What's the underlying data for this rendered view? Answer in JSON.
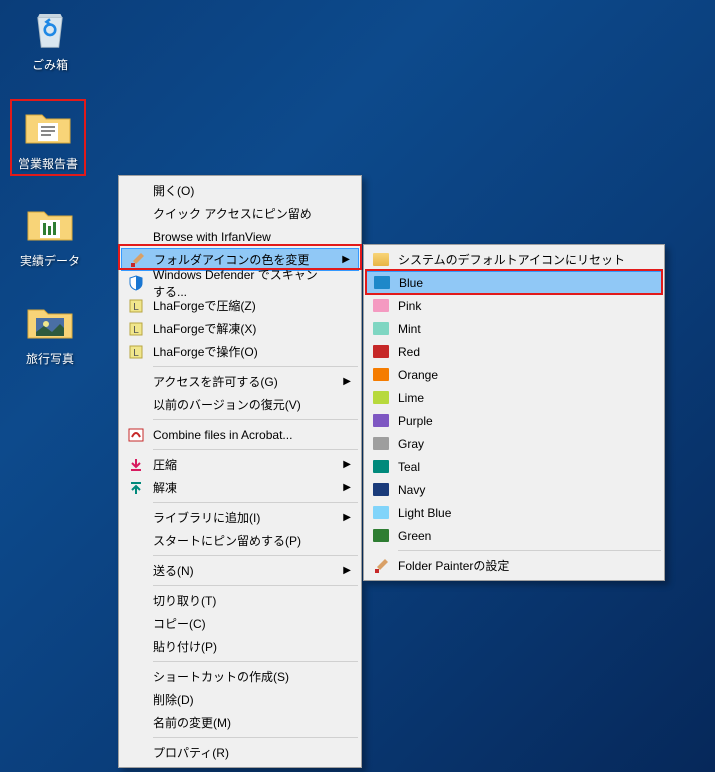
{
  "desktop": {
    "icons": [
      {
        "label": "ごみ箱"
      },
      {
        "label": "営業報告書"
      },
      {
        "label": "実績データ"
      },
      {
        "label": "旅行写真"
      }
    ]
  },
  "menu1": {
    "items": [
      {
        "label": "開く(O)"
      },
      {
        "label": "クイック アクセスにピン留め"
      },
      {
        "label": "Browse with IrfanView"
      },
      {
        "label": "フォルダアイコンの色を変更",
        "arrow": true,
        "hovered": true,
        "icon": "brush"
      },
      {
        "label": "Windows Defender でスキャンする...",
        "icon": "defender"
      },
      {
        "label": "LhaForgeで圧縮(Z)",
        "icon": "lha-z"
      },
      {
        "label": "LhaForgeで解凍(X)",
        "icon": "lha-x"
      },
      {
        "label": "LhaForgeで操作(O)",
        "icon": "lha-o"
      },
      {
        "sep": true
      },
      {
        "label": "アクセスを許可する(G)",
        "arrow": true
      },
      {
        "label": "以前のバージョンの復元(V)"
      },
      {
        "sep": true
      },
      {
        "label": "Combine files in Acrobat...",
        "icon": "acrobat"
      },
      {
        "sep": true
      },
      {
        "label": "圧縮",
        "arrow": true,
        "icon": "compress"
      },
      {
        "label": "解凍",
        "arrow": true,
        "icon": "decompress"
      },
      {
        "sep": true
      },
      {
        "label": "ライブラリに追加(I)",
        "arrow": true
      },
      {
        "label": "スタートにピン留めする(P)"
      },
      {
        "sep": true
      },
      {
        "label": "送る(N)",
        "arrow": true
      },
      {
        "sep": true
      },
      {
        "label": "切り取り(T)"
      },
      {
        "label": "コピー(C)"
      },
      {
        "label": "貼り付け(P)"
      },
      {
        "sep": true
      },
      {
        "label": "ショートカットの作成(S)"
      },
      {
        "label": "削除(D)"
      },
      {
        "label": "名前の変更(M)"
      },
      {
        "sep": true
      },
      {
        "label": "プロパティ(R)"
      }
    ]
  },
  "menu2": {
    "items": [
      {
        "label": "システムのデフォルトアイコンにリセット",
        "swatch": "#f8d478"
      },
      {
        "label": "Blue",
        "swatch": "#1e88c9",
        "hovered": true
      },
      {
        "label": "Pink",
        "swatch": "#f49ac1"
      },
      {
        "label": "Mint",
        "swatch": "#7fd6c2"
      },
      {
        "label": "Red",
        "swatch": "#c62828"
      },
      {
        "label": "Orange",
        "swatch": "#f57c00"
      },
      {
        "label": "Lime",
        "swatch": "#b7d93c"
      },
      {
        "label": "Purple",
        "swatch": "#7e57c2"
      },
      {
        "label": "Gray",
        "swatch": "#9e9e9e"
      },
      {
        "label": "Teal",
        "swatch": "#00897b"
      },
      {
        "label": "Navy",
        "swatch": "#1a3b7a"
      },
      {
        "label": "Light Blue",
        "swatch": "#81d4fa"
      },
      {
        "label": "Green",
        "swatch": "#2e7d32"
      },
      {
        "sep": true
      },
      {
        "label": "Folder Painterの設定",
        "icon": "brush"
      }
    ]
  }
}
